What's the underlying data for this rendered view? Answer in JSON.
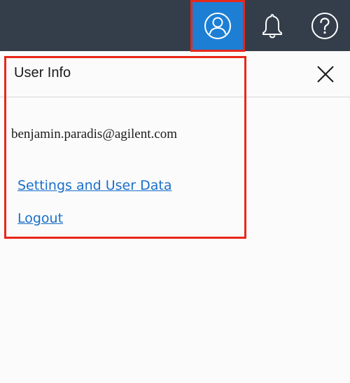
{
  "topbar": {
    "icons": [
      "user-circle-icon",
      "bell-icon",
      "help-circle-icon"
    ],
    "active_icon": "user-circle-icon",
    "background_color": "#333e4a",
    "active_color": "#1c7fd4"
  },
  "user_panel": {
    "title": "User Info",
    "close_icon": "close-icon",
    "email": "benjamin.paradis@agilent.com",
    "links": {
      "settings": "Settings and User Data",
      "logout": "Logout"
    },
    "link_color": "#1a6fc9"
  },
  "highlight_color": "#e8271b"
}
